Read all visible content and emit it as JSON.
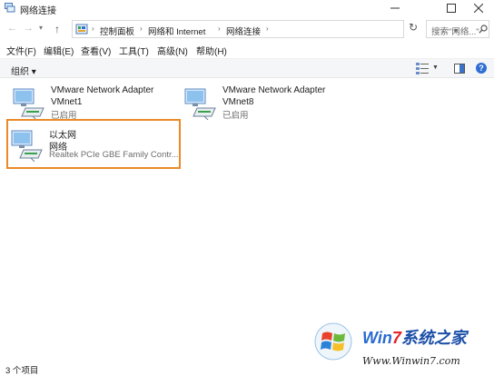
{
  "window": {
    "title": "网络连接"
  },
  "nav": {
    "breadcrumbs": [
      "控制面板",
      "网络和 Internet",
      "网络连接"
    ],
    "search_placeholder": "搜索\"网络...\""
  },
  "menu": [
    "文件(F)",
    "编辑(E)",
    "查看(V)",
    "工具(T)",
    "高级(N)",
    "帮助(H)"
  ],
  "toolbar": {
    "organize": "组织 ▾"
  },
  "adapters": [
    {
      "name": "VMware Network Adapter",
      "network": "VMnet1",
      "status": "已启用"
    },
    {
      "name": "VMware Network Adapter",
      "network": "VMnet8",
      "status": "已启用"
    },
    {
      "name": "以太网",
      "network": "网络",
      "status": "Realtek PCIe GBE Family Contr...",
      "selected": true
    }
  ],
  "statusbar": {
    "count": "3 个项目"
  },
  "watermark": {
    "brand_part1": "Win",
    "brand_part2": "7",
    "brand_part3": "系统之家",
    "url": "Www.Winwin7.com"
  },
  "colors": {
    "selection_border": "#ea8a28",
    "accent": "#2f6ed3"
  }
}
